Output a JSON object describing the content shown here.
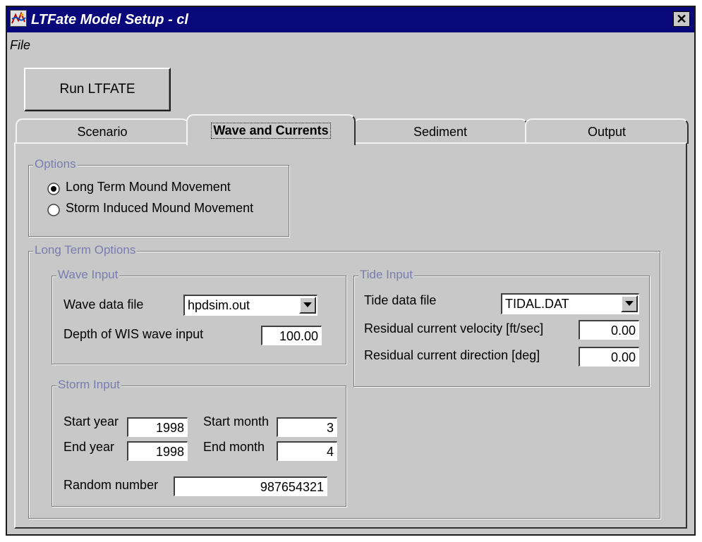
{
  "window": {
    "title": "LTFate Model Setup - cl",
    "close_label": "✕"
  },
  "menu": {
    "file": "File"
  },
  "toolbar": {
    "run_label": "Run LTFATE"
  },
  "tabs": [
    {
      "label": "Scenario",
      "active": false
    },
    {
      "label": "Wave and Currents",
      "active": true
    },
    {
      "label": "Sediment",
      "active": false
    },
    {
      "label": "Output",
      "active": false
    }
  ],
  "options": {
    "legend": "Options",
    "radios": [
      {
        "label": "Long Term Mound Movement",
        "selected": true
      },
      {
        "label": "Storm Induced Mound Movement",
        "selected": false
      }
    ]
  },
  "long_term": {
    "legend": "Long Term Options",
    "wave_input": {
      "legend": "Wave Input",
      "data_file_label": "Wave data file",
      "data_file_value": "hpdsim.out",
      "depth_label": "Depth of WIS wave input",
      "depth_value": "100.00"
    },
    "tide_input": {
      "legend": "Tide Input",
      "data_file_label": "Tide data file",
      "data_file_value": "TIDAL.DAT",
      "velocity_label": "Residual current velocity [ft/sec]",
      "velocity_value": "0.00",
      "direction_label": "Residual current direction [deg]",
      "direction_value": "0.00"
    },
    "storm_input": {
      "legend": "Storm Input",
      "start_year_label": "Start year",
      "start_year_value": "1998",
      "start_month_label": "Start month",
      "start_month_value": "3",
      "end_year_label": "End year",
      "end_year_value": "1998",
      "end_month_label": "End month",
      "end_month_value": "4",
      "random_label": "Random number",
      "random_value": "987654321"
    }
  },
  "colors": {
    "title_bar": "#08087a",
    "face": "#c8c8c8",
    "group_legend": "#7b7bb0"
  }
}
